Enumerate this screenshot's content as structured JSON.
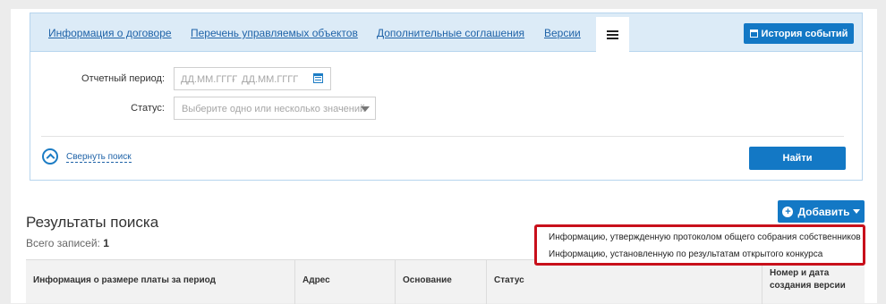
{
  "tabs": [
    {
      "label": "Информация о договоре"
    },
    {
      "label": "Перечень управляемых объектов"
    },
    {
      "label": "Дополнительные соглашения"
    },
    {
      "label": "Версии"
    }
  ],
  "history_button": {
    "label": "История событий"
  },
  "filters": {
    "period_label": "Отчетный период:",
    "date_from_placeholder": "ДД.ММ.ГГГГ",
    "date_sep": "-",
    "date_to_placeholder": "ДД.ММ.ГГГГ",
    "status_label": "Статус:",
    "status_placeholder": "Выберите одно или несколько значений"
  },
  "collapse_link": "Свернуть поиск",
  "find_button": "Найти",
  "results": {
    "title": "Результаты поиска",
    "total_label": "Всего записей:",
    "total_value": "1"
  },
  "add_button": {
    "label": "Добавить"
  },
  "add_menu": [
    "Информацию, утвержденную протоколом общего собрания собственников",
    "Информацию, установленную по результатам открытого конкурса"
  ],
  "table_headers": [
    "Информация о размере платы за период",
    "Адрес",
    "Основание",
    "Статус",
    "Номер и дата создания версии"
  ],
  "colors": {
    "accent": "#1378c5",
    "link": "#1f63a8",
    "highlight_border": "#c8101b",
    "tabbar_bg": "#dcebf7"
  }
}
